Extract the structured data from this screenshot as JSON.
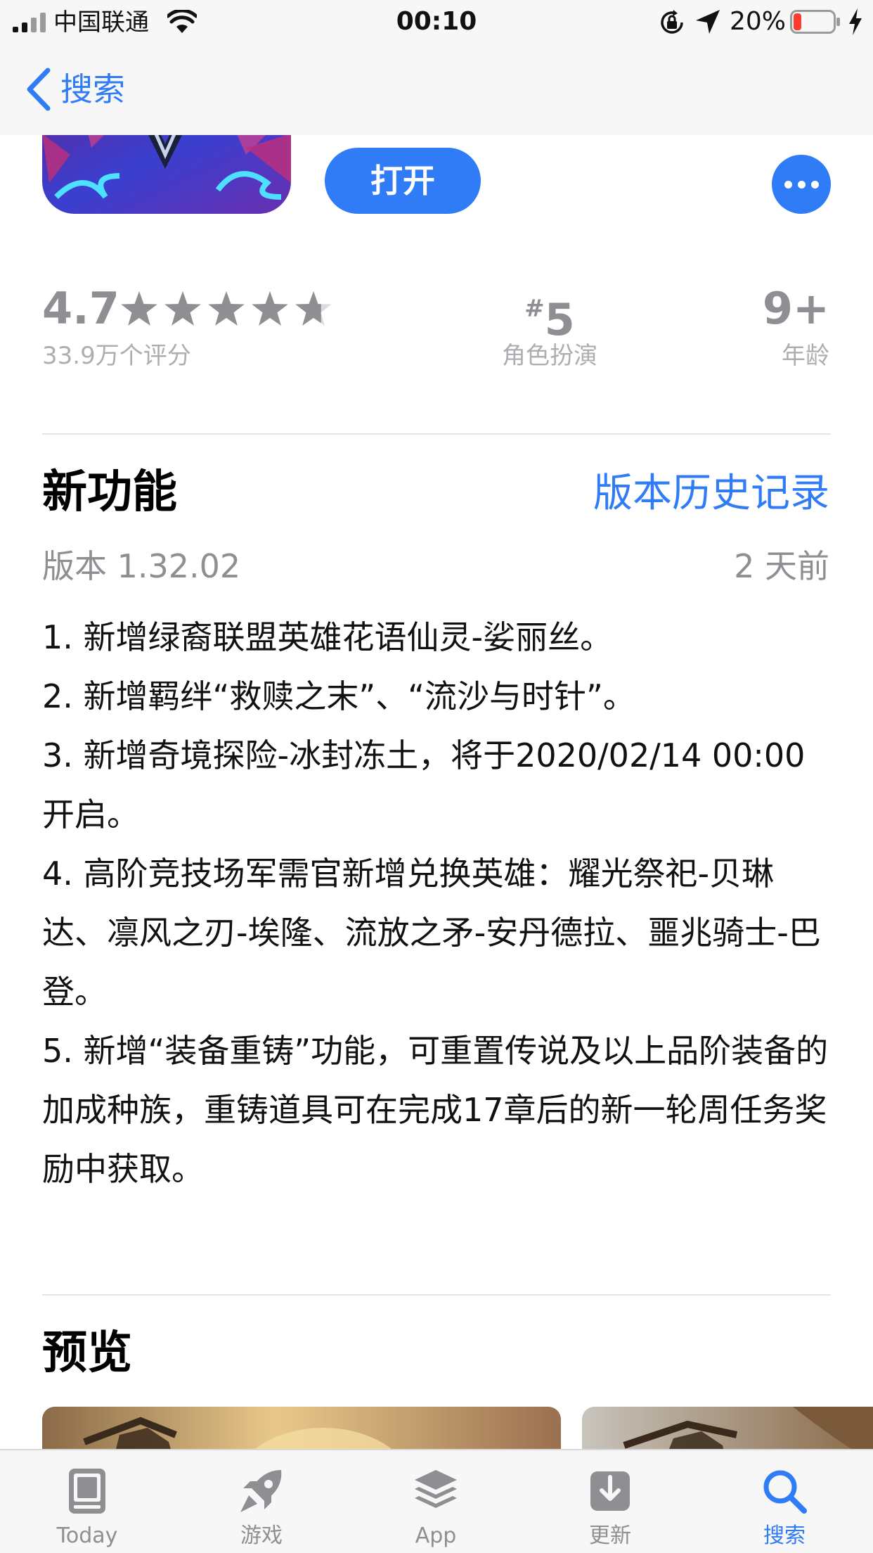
{
  "status_bar": {
    "carrier": "中国联通",
    "time": "00:10",
    "battery_percent": "20%",
    "battery_level": 0.2
  },
  "nav": {
    "back_label": "搜索"
  },
  "app": {
    "open_label": "打开"
  },
  "ratings": {
    "score": "4.7",
    "stars": 4.7,
    "count": "33.9万个评分",
    "rank_hash": "#",
    "rank_number": "5",
    "category": "角色扮演",
    "age": "9+",
    "age_label": "年龄"
  },
  "whats_new": {
    "title": "新功能",
    "history_link": "版本历史记录",
    "version": "版本 1.32.02",
    "date": "2 天前",
    "notes": [
      "1.  新增绿裔联盟英雄花语仙灵-娑丽丝。",
      "2. 新增羁绊“救赎之末”、“流沙与时针”。",
      "3. 新增奇境探险-冰封冻土，将于2020/02/14 00:00开启。",
      "4. 高阶竞技场军需官新增兑换英雄：耀光祭祀-贝琳达、凛风之刃-埃隆、流放之矛-安丹德拉、噩兆骑士-巴登。",
      "5. 新增“装备重铸”功能，可重置传说及以上品阶装备的加成种族，重铸道具可在完成17章后的新一轮周任务奖励中获取。"
    ]
  },
  "preview": {
    "title": "预览"
  },
  "tabs": [
    {
      "label": "Today",
      "icon": "today-icon"
    },
    {
      "label": "游戏",
      "icon": "rocket-icon"
    },
    {
      "label": "App",
      "icon": "layers-icon"
    },
    {
      "label": "更新",
      "icon": "download-icon"
    },
    {
      "label": "搜索",
      "icon": "search-icon"
    }
  ],
  "colors": {
    "accent": "#2f7cf6",
    "secondary_text": "#8e8e93",
    "battery_low": "#ff3b30"
  }
}
